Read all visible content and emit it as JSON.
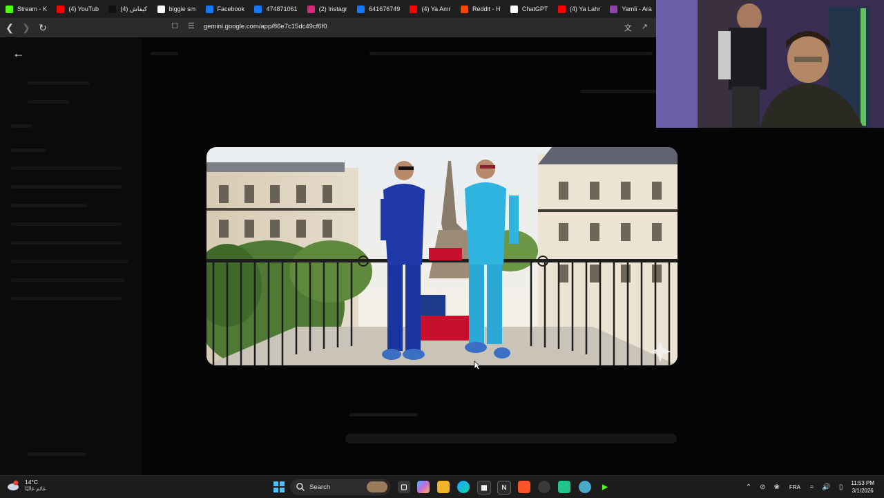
{
  "bookmarks": [
    {
      "label": "Stream - K",
      "icon": "kick-icon",
      "color": "#53fc18"
    },
    {
      "label": "(4) YouTub",
      "icon": "youtube-icon",
      "color": "#ff0000"
    },
    {
      "label": "كيفاش (4)",
      "icon": "tiktok-icon",
      "color": "#111111"
    },
    {
      "label": "biggie sm",
      "icon": "google-icon",
      "color": "#ffffff"
    },
    {
      "label": "Facebook",
      "icon": "facebook-icon",
      "color": "#1877f2"
    },
    {
      "label": "474871061",
      "icon": "facebook-icon",
      "color": "#1877f2"
    },
    {
      "label": "(2) Instagr",
      "icon": "instagram-icon",
      "color": "#d62976"
    },
    {
      "label": "641676749",
      "icon": "facebook-icon",
      "color": "#1877f2"
    },
    {
      "label": "(4) Ya Amr",
      "icon": "youtube-icon",
      "color": "#ff0000"
    },
    {
      "label": "Reddit - H",
      "icon": "reddit-icon",
      "color": "#ff4500"
    },
    {
      "label": "ChatGPT",
      "icon": "chatgpt-icon",
      "color": "#ffffff"
    },
    {
      "label": "(4) Ya Lahr",
      "icon": "youtube-icon",
      "color": "#ff0000"
    },
    {
      "label": "Yamli - Ara",
      "icon": "yamli-icon",
      "color": "#8e44ad"
    }
  ],
  "address": {
    "url": "gemini.google.com/app/86e7c15dc49cf6f0"
  },
  "taskbar": {
    "temperature": "14°C",
    "location": "غائم غالبًا",
    "search_label": "Search",
    "language": "FRA",
    "time": "11:53 PM",
    "date": "3/1/2026"
  },
  "colors": {
    "taskbar_bg": "#1c1c1c",
    "accent": "#4cc2ff"
  }
}
